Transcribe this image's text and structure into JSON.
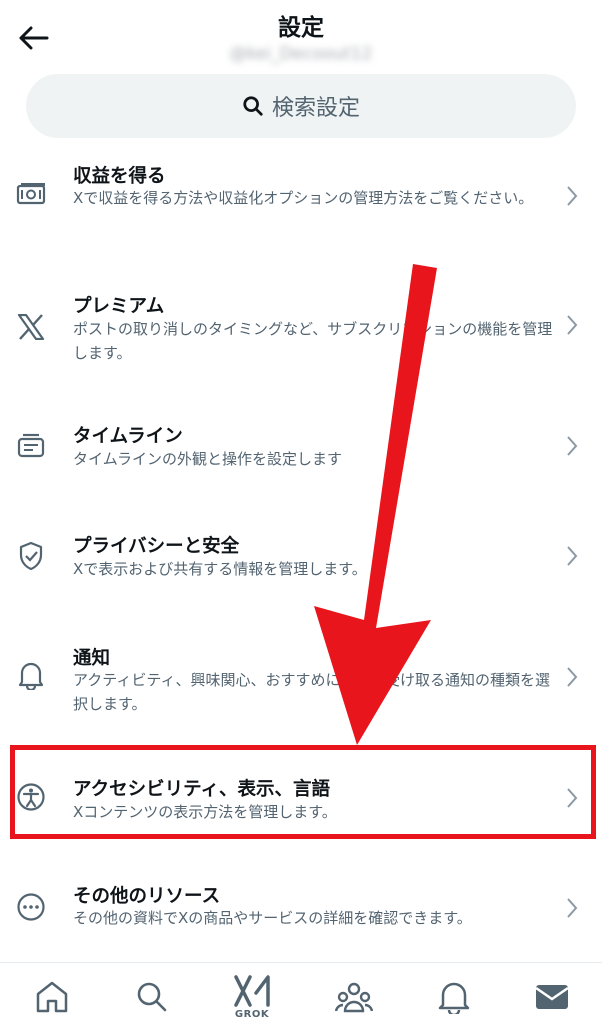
{
  "header": {
    "title": "設定",
    "subtitle": "@kei_Decoout12"
  },
  "search": {
    "label": "検索設定",
    "icon": "search-icon"
  },
  "menu": [
    {
      "title": "収益を得る",
      "desc": "Xで収益を得る方法や収益化オプションの管理方法をご覧ください。",
      "icon": "monetization-icon"
    },
    {
      "title": "プレミアム",
      "desc": "ポストの取り消しのタイミングなど、サブスクリプションの機能を管理します。",
      "icon": "x-logo-icon"
    },
    {
      "title": "タイムライン",
      "desc": "タイムラインの外観と操作を設定します",
      "icon": "timeline-icon"
    },
    {
      "title": "プライバシーと安全",
      "desc": "Xで表示および共有する情報を管理します。",
      "icon": "shield-icon"
    },
    {
      "title": "通知",
      "desc": "アクティビティ、興味関心、おすすめについて受け取る通知の種類を選択します。",
      "icon": "bell-icon"
    },
    {
      "title": "アクセシビリティ、表示、言語",
      "desc": "Xコンテンツの表示方法を管理します。",
      "icon": "accessibility-icon"
    },
    {
      "title": "その他のリソース",
      "desc": "その他の資料でXの商品やサービスの詳細を確認できます。",
      "icon": "more-icon"
    }
  ],
  "bottom_nav": {
    "items": [
      "home-icon",
      "search-icon",
      "grok-icon",
      "communities-icon",
      "notifications-icon",
      "messages-icon"
    ],
    "grok_label": "GROK"
  },
  "colors": {
    "highlight": "#e8161c",
    "arrow": "#e8161c",
    "text": "#0f1419",
    "secondary": "#536471"
  }
}
